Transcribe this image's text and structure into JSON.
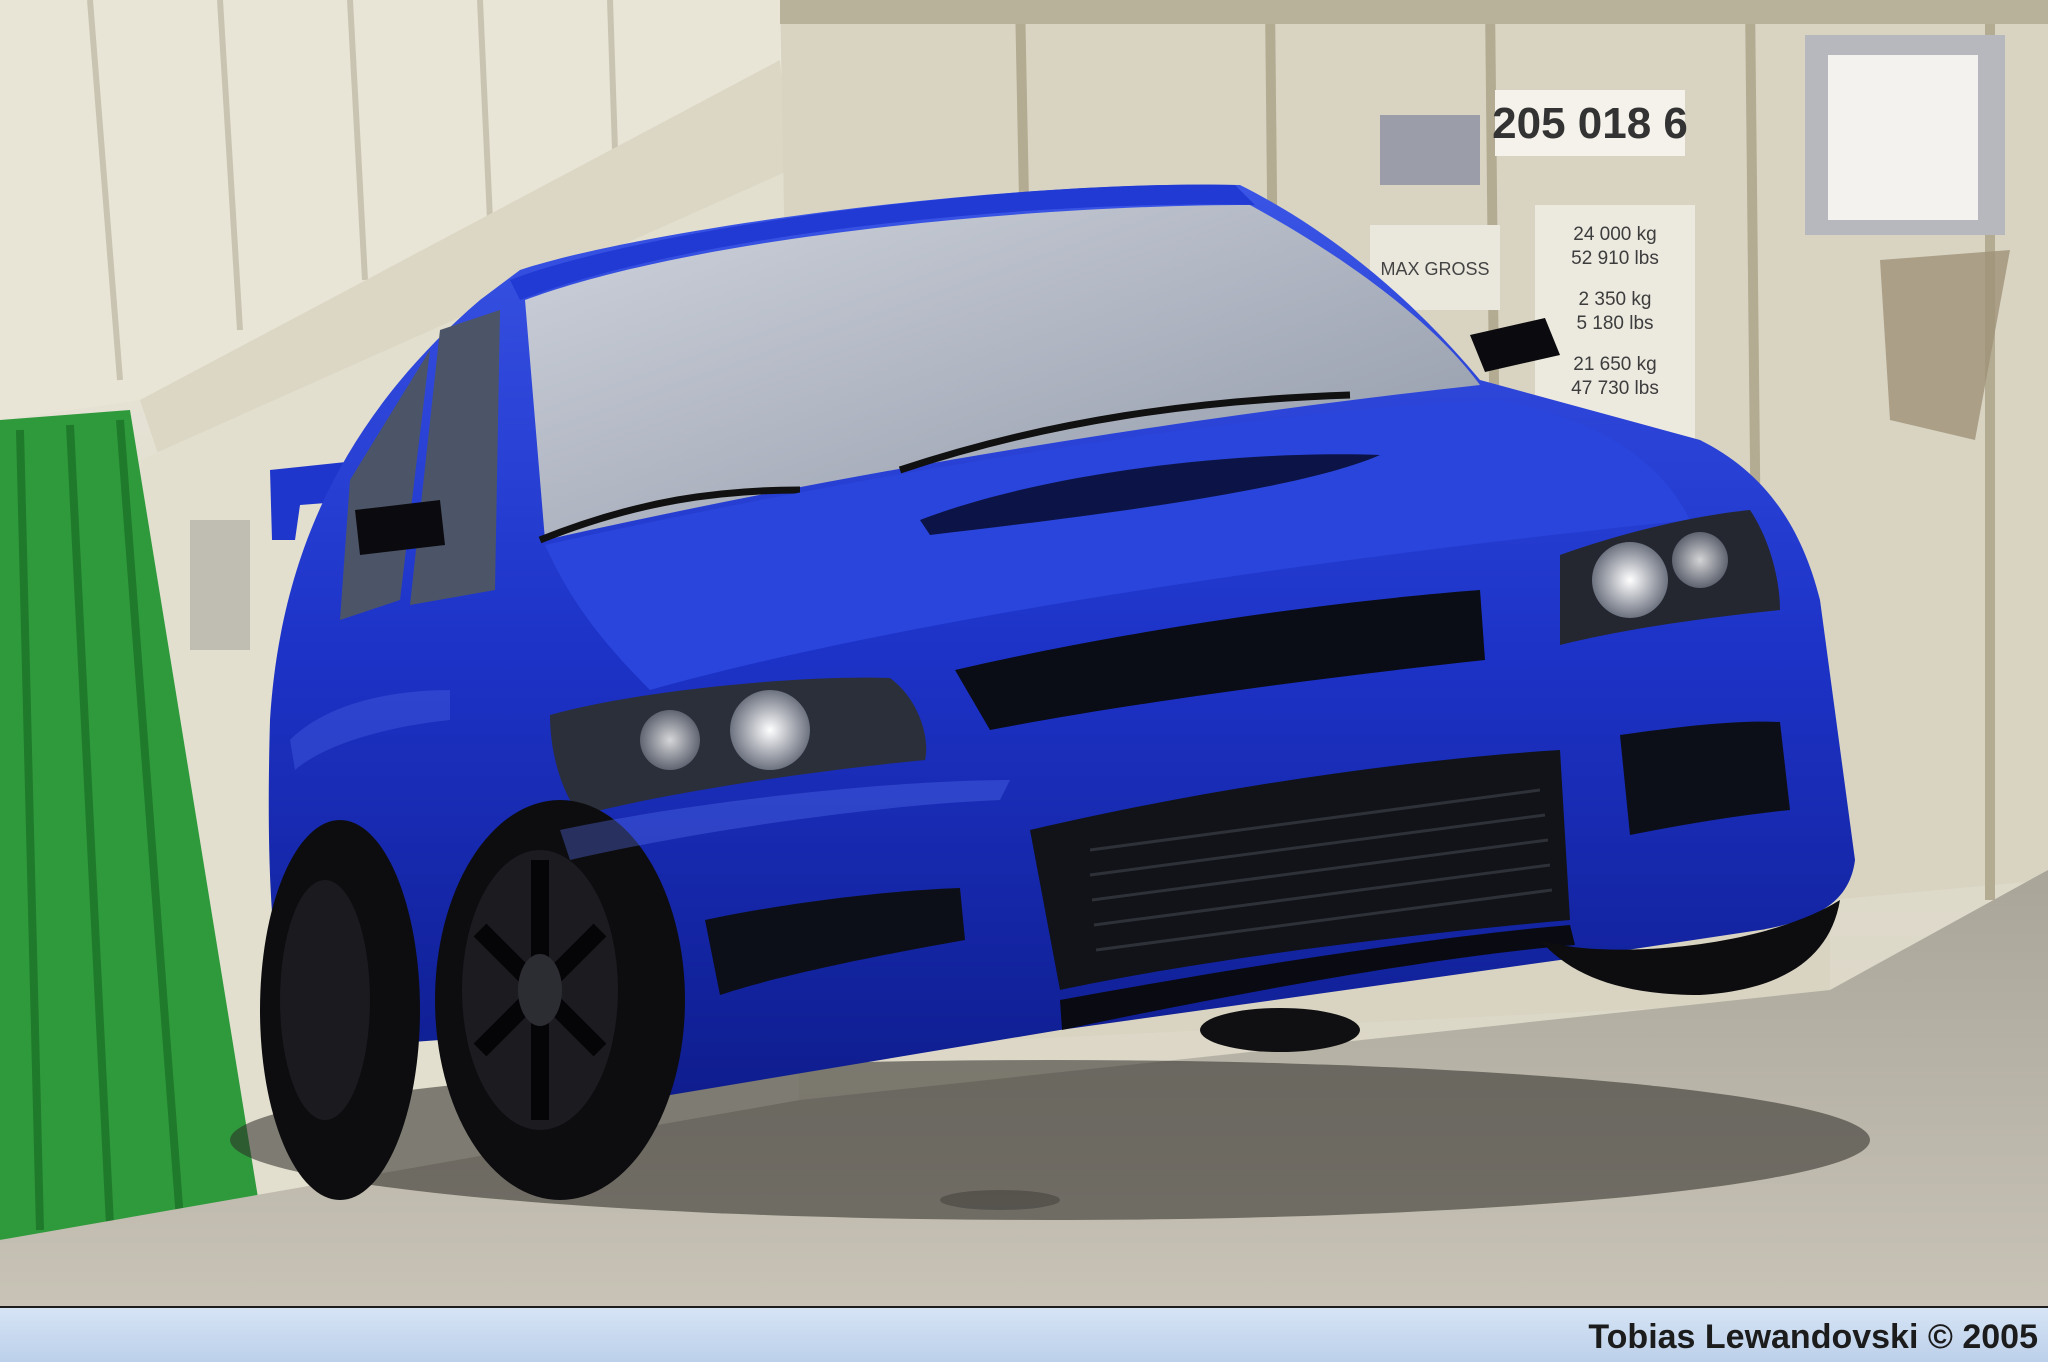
{
  "photo": {
    "subject": "blue sports sedan",
    "container_labels": {
      "container_number": "205 018 6",
      "max_gross": "MAX GROSS",
      "weights": [
        "24 000 kg",
        "52 910 lbs",
        "2 350 kg",
        "5 180 lbs",
        "21 650 kg",
        "47 730 lbs"
      ]
    },
    "colors": {
      "car_body": "#1d33c8",
      "car_shadow": "#0a1470",
      "container_green": "#2f9a3c",
      "container_white": "#e6e2d2",
      "ground": "#b9b4a7"
    }
  },
  "caption": {
    "credit": "Tobias Lewandovski © 2005"
  }
}
